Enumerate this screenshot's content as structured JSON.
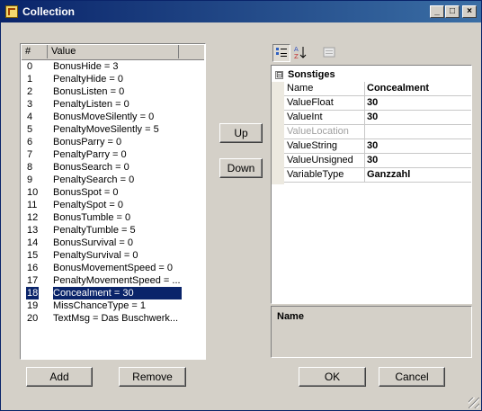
{
  "window": {
    "title": "Collection",
    "controls": {
      "minimize": "_",
      "maximize": "□",
      "close": "×"
    }
  },
  "members_list": {
    "headers": [
      "#",
      "Value"
    ],
    "rows": [
      {
        "index": "0",
        "value": "BonusHide = 3"
      },
      {
        "index": "1",
        "value": "PenaltyHide = 0"
      },
      {
        "index": "2",
        "value": "BonusListen = 0"
      },
      {
        "index": "3",
        "value": "PenaltyListen = 0"
      },
      {
        "index": "4",
        "value": "BonusMoveSilently = 0"
      },
      {
        "index": "5",
        "value": "PenaltyMoveSilently = 5"
      },
      {
        "index": "6",
        "value": "BonusParry  = 0"
      },
      {
        "index": "7",
        "value": "PenaltyParry = 0"
      },
      {
        "index": "8",
        "value": "BonusSearch = 0"
      },
      {
        "index": "9",
        "value": "PenaltySearch = 0"
      },
      {
        "index": "10",
        "value": "BonusSpot = 0"
      },
      {
        "index": "11",
        "value": "PenaltySpot = 0"
      },
      {
        "index": "12",
        "value": "BonusTumble = 0"
      },
      {
        "index": "13",
        "value": "PenaltyTumble = 5"
      },
      {
        "index": "14",
        "value": "BonusSurvival = 0"
      },
      {
        "index": "15",
        "value": "PenaltySurvival = 0"
      },
      {
        "index": "16",
        "value": "BonusMovementSpeed = 0"
      },
      {
        "index": "17",
        "value": "PenaltyMovementSpeed = ..."
      },
      {
        "index": "18",
        "value": "Concealment = 30"
      },
      {
        "index": "19",
        "value": "MissChanceType = 1"
      },
      {
        "index": "20",
        "value": "TextMsg = Das Buschwerk..."
      }
    ],
    "selected_index": 18
  },
  "buttons": {
    "up": "Up",
    "down": "Down",
    "add": "Add",
    "remove": "Remove",
    "ok": "OK",
    "cancel": "Cancel"
  },
  "property_grid": {
    "toolbar": {
      "categorized_icon": "categorized-icon",
      "alphabetical_icon": "alphabetical-az-icon",
      "property_pages_icon": "property-pages-icon"
    },
    "category": "Sonstiges",
    "expander": "⊟",
    "properties": [
      {
        "name": "Name",
        "value": "Concealment",
        "enabled": true
      },
      {
        "name": "ValueFloat",
        "value": "30",
        "enabled": true
      },
      {
        "name": "ValueInt",
        "value": "30",
        "enabled": true
      },
      {
        "name": "ValueLocation",
        "value": "",
        "enabled": false
      },
      {
        "name": "ValueString",
        "value": "30",
        "enabled": true
      },
      {
        "name": "ValueUnsigned",
        "value": "30",
        "enabled": true
      },
      {
        "name": "VariableType",
        "value": "Ganzzahl",
        "enabled": true
      }
    ],
    "help_title": "Name"
  },
  "colors": {
    "titlebar_start": "#0a246a",
    "titlebar_end": "#3a6ea5",
    "selection": "#0a246a",
    "dialog_bg": "#d4d0c8"
  }
}
